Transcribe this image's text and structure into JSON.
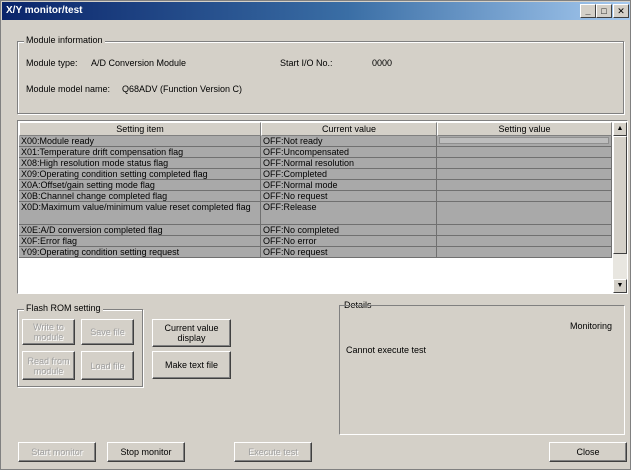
{
  "window": {
    "title": "X/Y monitor/test",
    "controls": [
      "_",
      "□",
      "✕"
    ]
  },
  "module_info": {
    "legend": "Module information",
    "type_label": "Module type:",
    "type_value": "A/D Conversion Module",
    "start_io_label": "Start I/O No.:",
    "start_io_value": "0000",
    "model_label": "Module model name:",
    "model_value": "Q68ADV (Function Version C)"
  },
  "table": {
    "headers": [
      "Setting item",
      "Current value",
      "Setting value"
    ],
    "rows": [
      {
        "item": "X00:Module ready",
        "current": "OFF:Not ready",
        "setting": ""
      },
      {
        "item": "X01:Temperature drift compensation flag",
        "current": "OFF:Uncompensated",
        "setting": ""
      },
      {
        "item": "X08:High resolution mode status flag",
        "current": "OFF:Normal resolution",
        "setting": ""
      },
      {
        "item": "X09:Operating condition setting completed flag",
        "current": "OFF:Completed",
        "setting": ""
      },
      {
        "item": "X0A:Offset/gain setting mode flag",
        "current": "OFF:Normal mode",
        "setting": ""
      },
      {
        "item": "X0B:Channel change completed flag",
        "current": "OFF:No request",
        "setting": ""
      },
      {
        "item": "X0D:Maximum value/minimum value reset completed flag",
        "current": "OFF:Release",
        "setting": ""
      },
      {
        "item": "X0E:A/D conversion completed flag",
        "current": "OFF:No completed",
        "setting": ""
      },
      {
        "item": "X0F:Error flag",
        "current": "OFF:No error",
        "setting": ""
      },
      {
        "item": "Y09:Operating condition setting request",
        "current": "OFF:No request",
        "setting": ""
      }
    ]
  },
  "flash_rom": {
    "legend": "Flash ROM setting",
    "write_to_module": "Write to\nmodule",
    "save_file": "Save file",
    "read_from_module": "Read from\nmodule",
    "load_file": "Load file"
  },
  "buttons": {
    "current_value_display": "Current value\ndisplay",
    "make_text_file": "Make text file",
    "start_monitor": "Start monitor",
    "stop_monitor": "Stop monitor",
    "execute_test": "Execute test",
    "close": "Close"
  },
  "details": {
    "legend": "Details",
    "status": "Monitoring",
    "message": "Cannot execute test"
  }
}
